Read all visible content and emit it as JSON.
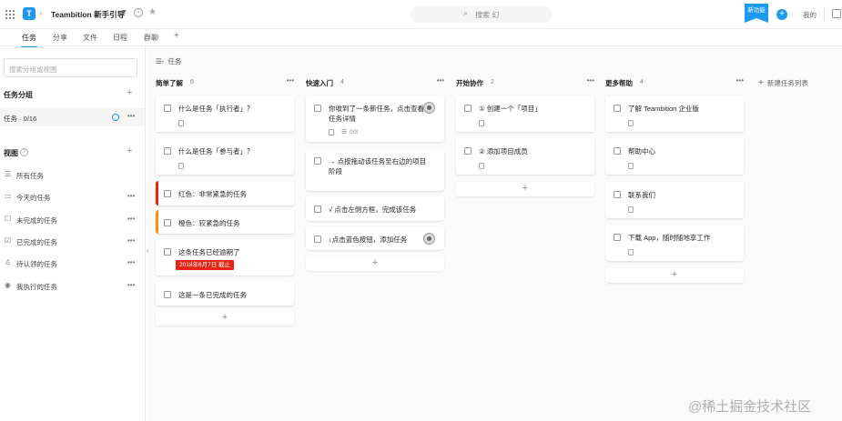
{
  "header": {
    "project_title": "Teambition 新手引导",
    "search_label": "搜索",
    "search_placeholder_suffix": "幻",
    "new_badge": "新功能",
    "my_label": "我的"
  },
  "tabs": [
    {
      "label": "任务",
      "active": true
    },
    {
      "label": "分享"
    },
    {
      "label": "文件"
    },
    {
      "label": "日程"
    },
    {
      "label": "群聊"
    }
  ],
  "sidebar": {
    "search_placeholder": "搜索分组或视图",
    "groups_title": "任务分组",
    "group_item": "任务 · 0/16",
    "views_title": "视图",
    "views": [
      {
        "label": "所有任务",
        "icon": "list-icon"
      },
      {
        "label": "今天的任务",
        "icon": "calendar-icon"
      },
      {
        "label": "未完成的任务",
        "icon": "square-icon"
      },
      {
        "label": "已完成的任务",
        "icon": "checked-square-icon"
      },
      {
        "label": "待认领的任务",
        "icon": "person-icon"
      },
      {
        "label": "我执行的任务",
        "icon": "user-circle-icon"
      }
    ]
  },
  "board": {
    "breadcrumb": "任务",
    "new_list_label": "新建任务列表",
    "columns": [
      {
        "title": "简单了解",
        "count": "6",
        "cards": [
          {
            "text": "什么是任务「执行者」？"
          },
          {
            "text": "什么是任务「参与者」？"
          },
          {
            "text": "红色：非常紧急的任务"
          },
          {
            "text": "橙色：较紧急的任务"
          },
          {
            "text": "这条任务已经逾期了",
            "due": "2018年6月7日 截止"
          },
          {
            "text": "这是一条已完成的任务"
          }
        ]
      },
      {
        "title": "快速入门",
        "count": "4",
        "cards": [
          {
            "text": "你收到了一条新任务，点击查看任务详情",
            "subtasks": "0/3"
          },
          {
            "text": "→ 点按拖动该任务至右边的项目阶段"
          },
          {
            "text": "√ 点击左侧方框，完成该任务"
          },
          {
            "text": "↓点击蓝色按钮，添加任务"
          }
        ]
      },
      {
        "title": "开始协作",
        "count": "2",
        "cards": [
          {
            "text": "① 创建一个「项目」"
          },
          {
            "text": "② 添加项目成员"
          }
        ]
      },
      {
        "title": "更多帮助",
        "count": "4",
        "cards": [
          {
            "text": "了解 Teambition 企业版"
          },
          {
            "text": "帮助中心"
          },
          {
            "text": "联系我们"
          },
          {
            "text": "下载 App，随时随地享工作"
          }
        ]
      }
    ]
  },
  "watermark": "@稀土掘金技术社区",
  "colors": {
    "accent": "#1b9aee",
    "urgent": "#e62412",
    "warning": "#fa8c15"
  }
}
